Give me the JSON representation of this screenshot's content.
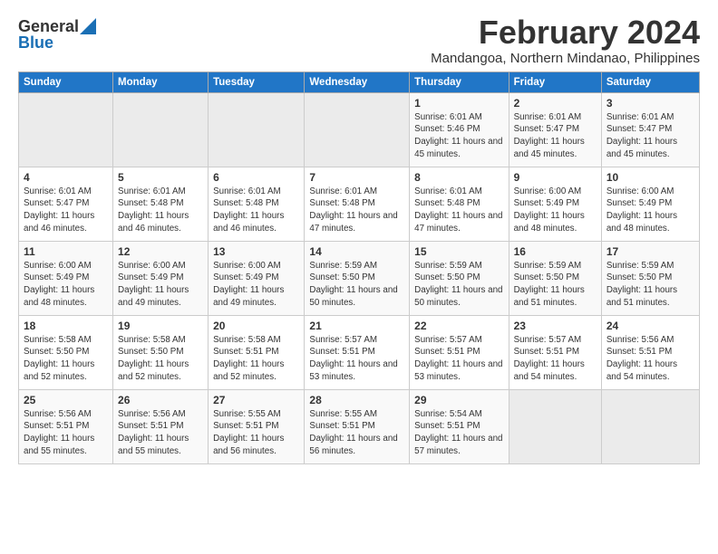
{
  "logo": {
    "general": "General",
    "blue": "Blue"
  },
  "title": {
    "month": "February 2024",
    "location": "Mandangoa, Northern Mindanao, Philippines"
  },
  "headers": [
    "Sunday",
    "Monday",
    "Tuesday",
    "Wednesday",
    "Thursday",
    "Friday",
    "Saturday"
  ],
  "weeks": [
    [
      {
        "day": "",
        "info": ""
      },
      {
        "day": "",
        "info": ""
      },
      {
        "day": "",
        "info": ""
      },
      {
        "day": "",
        "info": ""
      },
      {
        "day": "1",
        "info": "Sunrise: 6:01 AM\nSunset: 5:46 PM\nDaylight: 11 hours and 45 minutes."
      },
      {
        "day": "2",
        "info": "Sunrise: 6:01 AM\nSunset: 5:47 PM\nDaylight: 11 hours and 45 minutes."
      },
      {
        "day": "3",
        "info": "Sunrise: 6:01 AM\nSunset: 5:47 PM\nDaylight: 11 hours and 45 minutes."
      }
    ],
    [
      {
        "day": "4",
        "info": "Sunrise: 6:01 AM\nSunset: 5:47 PM\nDaylight: 11 hours and 46 minutes."
      },
      {
        "day": "5",
        "info": "Sunrise: 6:01 AM\nSunset: 5:48 PM\nDaylight: 11 hours and 46 minutes."
      },
      {
        "day": "6",
        "info": "Sunrise: 6:01 AM\nSunset: 5:48 PM\nDaylight: 11 hours and 46 minutes."
      },
      {
        "day": "7",
        "info": "Sunrise: 6:01 AM\nSunset: 5:48 PM\nDaylight: 11 hours and 47 minutes."
      },
      {
        "day": "8",
        "info": "Sunrise: 6:01 AM\nSunset: 5:48 PM\nDaylight: 11 hours and 47 minutes."
      },
      {
        "day": "9",
        "info": "Sunrise: 6:00 AM\nSunset: 5:49 PM\nDaylight: 11 hours and 48 minutes."
      },
      {
        "day": "10",
        "info": "Sunrise: 6:00 AM\nSunset: 5:49 PM\nDaylight: 11 hours and 48 minutes."
      }
    ],
    [
      {
        "day": "11",
        "info": "Sunrise: 6:00 AM\nSunset: 5:49 PM\nDaylight: 11 hours and 48 minutes."
      },
      {
        "day": "12",
        "info": "Sunrise: 6:00 AM\nSunset: 5:49 PM\nDaylight: 11 hours and 49 minutes."
      },
      {
        "day": "13",
        "info": "Sunrise: 6:00 AM\nSunset: 5:49 PM\nDaylight: 11 hours and 49 minutes."
      },
      {
        "day": "14",
        "info": "Sunrise: 5:59 AM\nSunset: 5:50 PM\nDaylight: 11 hours and 50 minutes."
      },
      {
        "day": "15",
        "info": "Sunrise: 5:59 AM\nSunset: 5:50 PM\nDaylight: 11 hours and 50 minutes."
      },
      {
        "day": "16",
        "info": "Sunrise: 5:59 AM\nSunset: 5:50 PM\nDaylight: 11 hours and 51 minutes."
      },
      {
        "day": "17",
        "info": "Sunrise: 5:59 AM\nSunset: 5:50 PM\nDaylight: 11 hours and 51 minutes."
      }
    ],
    [
      {
        "day": "18",
        "info": "Sunrise: 5:58 AM\nSunset: 5:50 PM\nDaylight: 11 hours and 52 minutes."
      },
      {
        "day": "19",
        "info": "Sunrise: 5:58 AM\nSunset: 5:50 PM\nDaylight: 11 hours and 52 minutes."
      },
      {
        "day": "20",
        "info": "Sunrise: 5:58 AM\nSunset: 5:51 PM\nDaylight: 11 hours and 52 minutes."
      },
      {
        "day": "21",
        "info": "Sunrise: 5:57 AM\nSunset: 5:51 PM\nDaylight: 11 hours and 53 minutes."
      },
      {
        "day": "22",
        "info": "Sunrise: 5:57 AM\nSunset: 5:51 PM\nDaylight: 11 hours and 53 minutes."
      },
      {
        "day": "23",
        "info": "Sunrise: 5:57 AM\nSunset: 5:51 PM\nDaylight: 11 hours and 54 minutes."
      },
      {
        "day": "24",
        "info": "Sunrise: 5:56 AM\nSunset: 5:51 PM\nDaylight: 11 hours and 54 minutes."
      }
    ],
    [
      {
        "day": "25",
        "info": "Sunrise: 5:56 AM\nSunset: 5:51 PM\nDaylight: 11 hours and 55 minutes."
      },
      {
        "day": "26",
        "info": "Sunrise: 5:56 AM\nSunset: 5:51 PM\nDaylight: 11 hours and 55 minutes."
      },
      {
        "day": "27",
        "info": "Sunrise: 5:55 AM\nSunset: 5:51 PM\nDaylight: 11 hours and 56 minutes."
      },
      {
        "day": "28",
        "info": "Sunrise: 5:55 AM\nSunset: 5:51 PM\nDaylight: 11 hours and 56 minutes."
      },
      {
        "day": "29",
        "info": "Sunrise: 5:54 AM\nSunset: 5:51 PM\nDaylight: 11 hours and 57 minutes."
      },
      {
        "day": "",
        "info": ""
      },
      {
        "day": "",
        "info": ""
      }
    ]
  ]
}
